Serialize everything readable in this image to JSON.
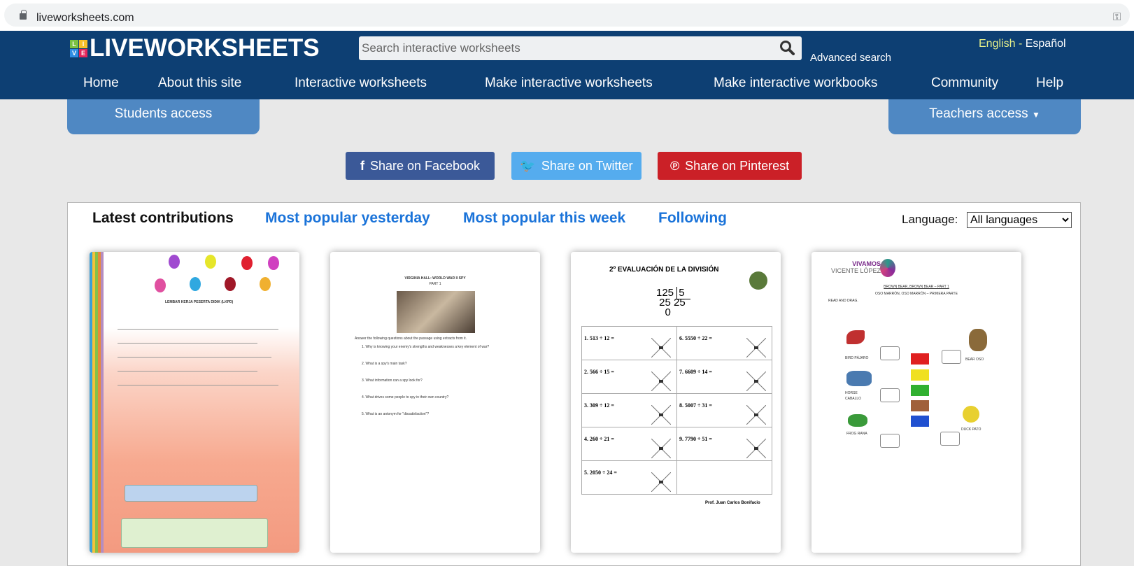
{
  "browser": {
    "url": "liveworksheets.com",
    "icons": [
      "lock-icon",
      "key-icon"
    ]
  },
  "header": {
    "logo_blocks": [
      "L",
      "I",
      "V",
      "E"
    ],
    "logo_text": "LIVEWORKSHEETS",
    "search_placeholder": "Search interactive worksheets",
    "advanced_search": "Advanced search",
    "lang_en": "English",
    "lang_sep": "-",
    "lang_es": "Español",
    "nav": [
      "Home",
      "About this site",
      "Interactive worksheets",
      "Make interactive worksheets",
      "Make interactive workbooks",
      "Community",
      "Help"
    ],
    "students_access": "Students access",
    "teachers_access": "Teachers access"
  },
  "share": {
    "facebook": "Share on Facebook",
    "twitter": "Share on Twitter",
    "pinterest": "Share on Pinterest",
    "colors": {
      "facebook": "#3b5998",
      "twitter": "#55acee",
      "pinterest": "#cb2027"
    }
  },
  "tabs": [
    "Latest contributions",
    "Most popular yesterday",
    "Most popular this week",
    "Following"
  ],
  "language_label": "Language:",
  "language_value": "All languages",
  "worksheets": [
    {
      "title": "LEMBAR KERJA PESERTA DIDIK (LKPD)"
    },
    {
      "title": "VIRGINIA HALL: WORLD WAR II SPY",
      "subtitle": "PART 1",
      "intro": "Answer the following questions about the passage using extracts from it.",
      "questions": [
        "1. Why is knowing your enemy's strengths and weaknesses a key element of war?",
        "2. What is a spy's main task?",
        "3. What information can a spy look for?",
        "4. What drives some people to spy in their own country?",
        "5. What is an antonym for \"dissatisfaction\"?"
      ]
    },
    {
      "title": "2º EVALUACIÓN DE LA DIVISIÓN",
      "example": [
        "125",
        "5",
        "25",
        "25",
        "0"
      ],
      "problems": [
        "1. 513 ÷ 12 =",
        "6. 5550 ÷ 22 =",
        "2. 566 ÷ 15 =",
        "7. 6609 ÷ 14 =",
        "3. 309 ÷ 12 =",
        "8. 5007 ÷ 31 =",
        "4. 260 ÷ 21 =",
        "9. 7790 ÷ 51 =",
        "5. 2050 ÷ 24 ="
      ],
      "author": "Prof. Juan Carlos Bonifacio"
    },
    {
      "logo_line1": "VIVAMOS",
      "logo_line2": "VICENTE LÓPEZ",
      "title": "BROWN BEAR, BROWN BEAR – PART 1",
      "subtitle": "OSO MARRÓN, OSO MARRÓN – PRIMERA PARTE",
      "instruction": "READ AND DRAG.",
      "labels": [
        "BIRD PÁJARO",
        "BEAR OSO",
        "HORSE CABALLO",
        "FROG RANA",
        "DUCK PATO"
      ]
    }
  ]
}
